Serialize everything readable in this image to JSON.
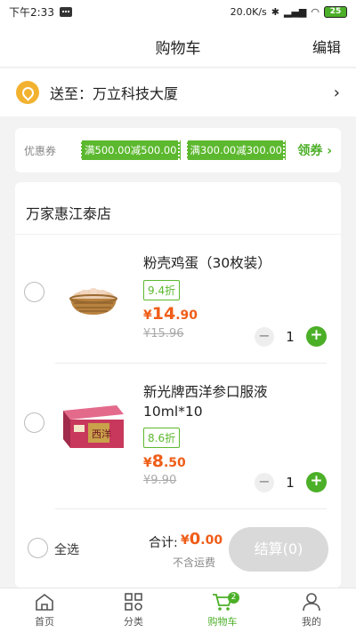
{
  "status_bar": {
    "time": "下午2:33",
    "network_speed": "20.0K/s",
    "battery": "25"
  },
  "header": {
    "title": "购物车",
    "edit_label": "编辑"
  },
  "address": {
    "text": "送至：万立科技大厦"
  },
  "coupon": {
    "label": "优惠券",
    "tags": [
      "满500.00减500.00",
      "满300.00减300.00"
    ],
    "get_label": "领券 ›"
  },
  "shop": {
    "name": "万家惠江泰店",
    "items": [
      {
        "name": "粉壳鸡蛋（30枚装）",
        "discount": "9.4折",
        "price_symbol": "¥",
        "price_int": "14",
        "price_dec": ".90",
        "original_price": "¥15.96",
        "quantity": "1"
      },
      {
        "name": "新光牌西洋参口服液10ml*10",
        "discount": "8.6折",
        "price_symbol": "¥",
        "price_int": "8",
        "price_dec": ".50",
        "original_price": "¥9.90",
        "quantity": "1"
      }
    ]
  },
  "footer": {
    "select_all": "全选",
    "total_label": "合计:",
    "total_symbol": "¥",
    "total_int": "0",
    "total_dec": ".00",
    "shipping_note": "不含运费",
    "checkout_label": "结算(0)"
  },
  "tabbar": {
    "items": [
      {
        "label": "首页",
        "icon": "home-icon"
      },
      {
        "label": "分类",
        "icon": "category-icon"
      },
      {
        "label": "购物车",
        "icon": "cart-icon",
        "badge": "2",
        "active": true
      },
      {
        "label": "我的",
        "icon": "user-icon"
      }
    ]
  },
  "colors": {
    "accent": "#4caf28",
    "price": "#ef5d18",
    "address_pin": "#f2b230"
  }
}
